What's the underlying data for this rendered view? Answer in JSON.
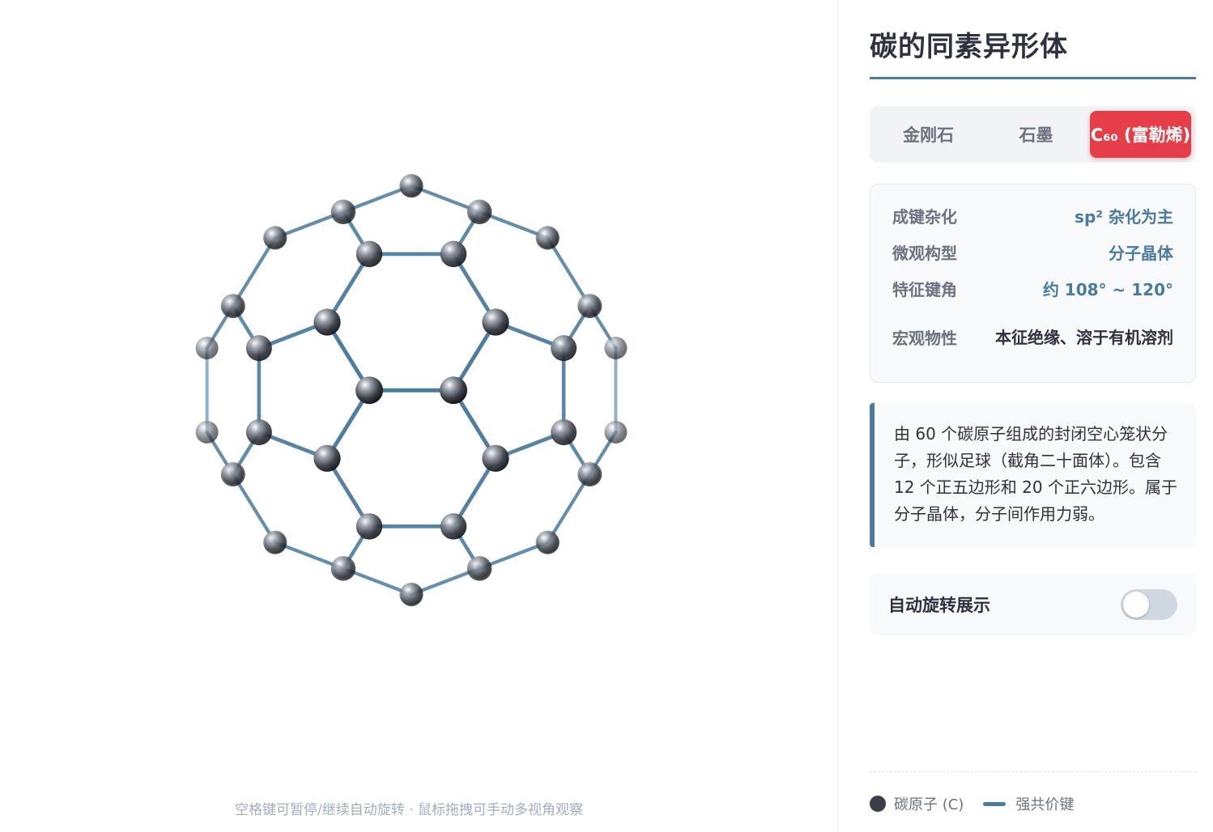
{
  "viewer": {
    "hint": "空格键可暂停/继续自动旋转 · 鼠标拖拽可手动多视角观察",
    "colors": {
      "bond": "#4a7a9c",
      "atom_dark": "#33383f",
      "atom_light": "#dfe3e8"
    }
  },
  "panel": {
    "title": "碳的同素异形体",
    "tabs": [
      {
        "label": "金刚石",
        "active": false
      },
      {
        "label": "石墨",
        "active": false
      },
      {
        "label": "C₆₀ (富勒烯)",
        "active": true
      }
    ],
    "properties": [
      {
        "key": "成键杂化",
        "value": "sp² 杂化为主"
      },
      {
        "key": "微观构型",
        "value": "分子晶体"
      },
      {
        "key": "特征键角",
        "value": "约 108° ~ 120°"
      },
      {
        "key": "宏观物性",
        "value": "本征绝缘、溶于有机溶剂"
      }
    ],
    "description": "由 60 个碳原子组成的封闭空心笼状分子，形似足球（截角二十面体）。包含 12 个正五边形和 20 个正六边形。属于分子晶体，分子间作用力弱。",
    "auto_rotate": {
      "label": "自动旋转展示",
      "on": false
    },
    "legend": {
      "atom": "碳原子 (C)",
      "bond": "强共价键"
    },
    "colors": {
      "accent": "#4a7a9c",
      "active_tab": "#e53e49"
    }
  }
}
